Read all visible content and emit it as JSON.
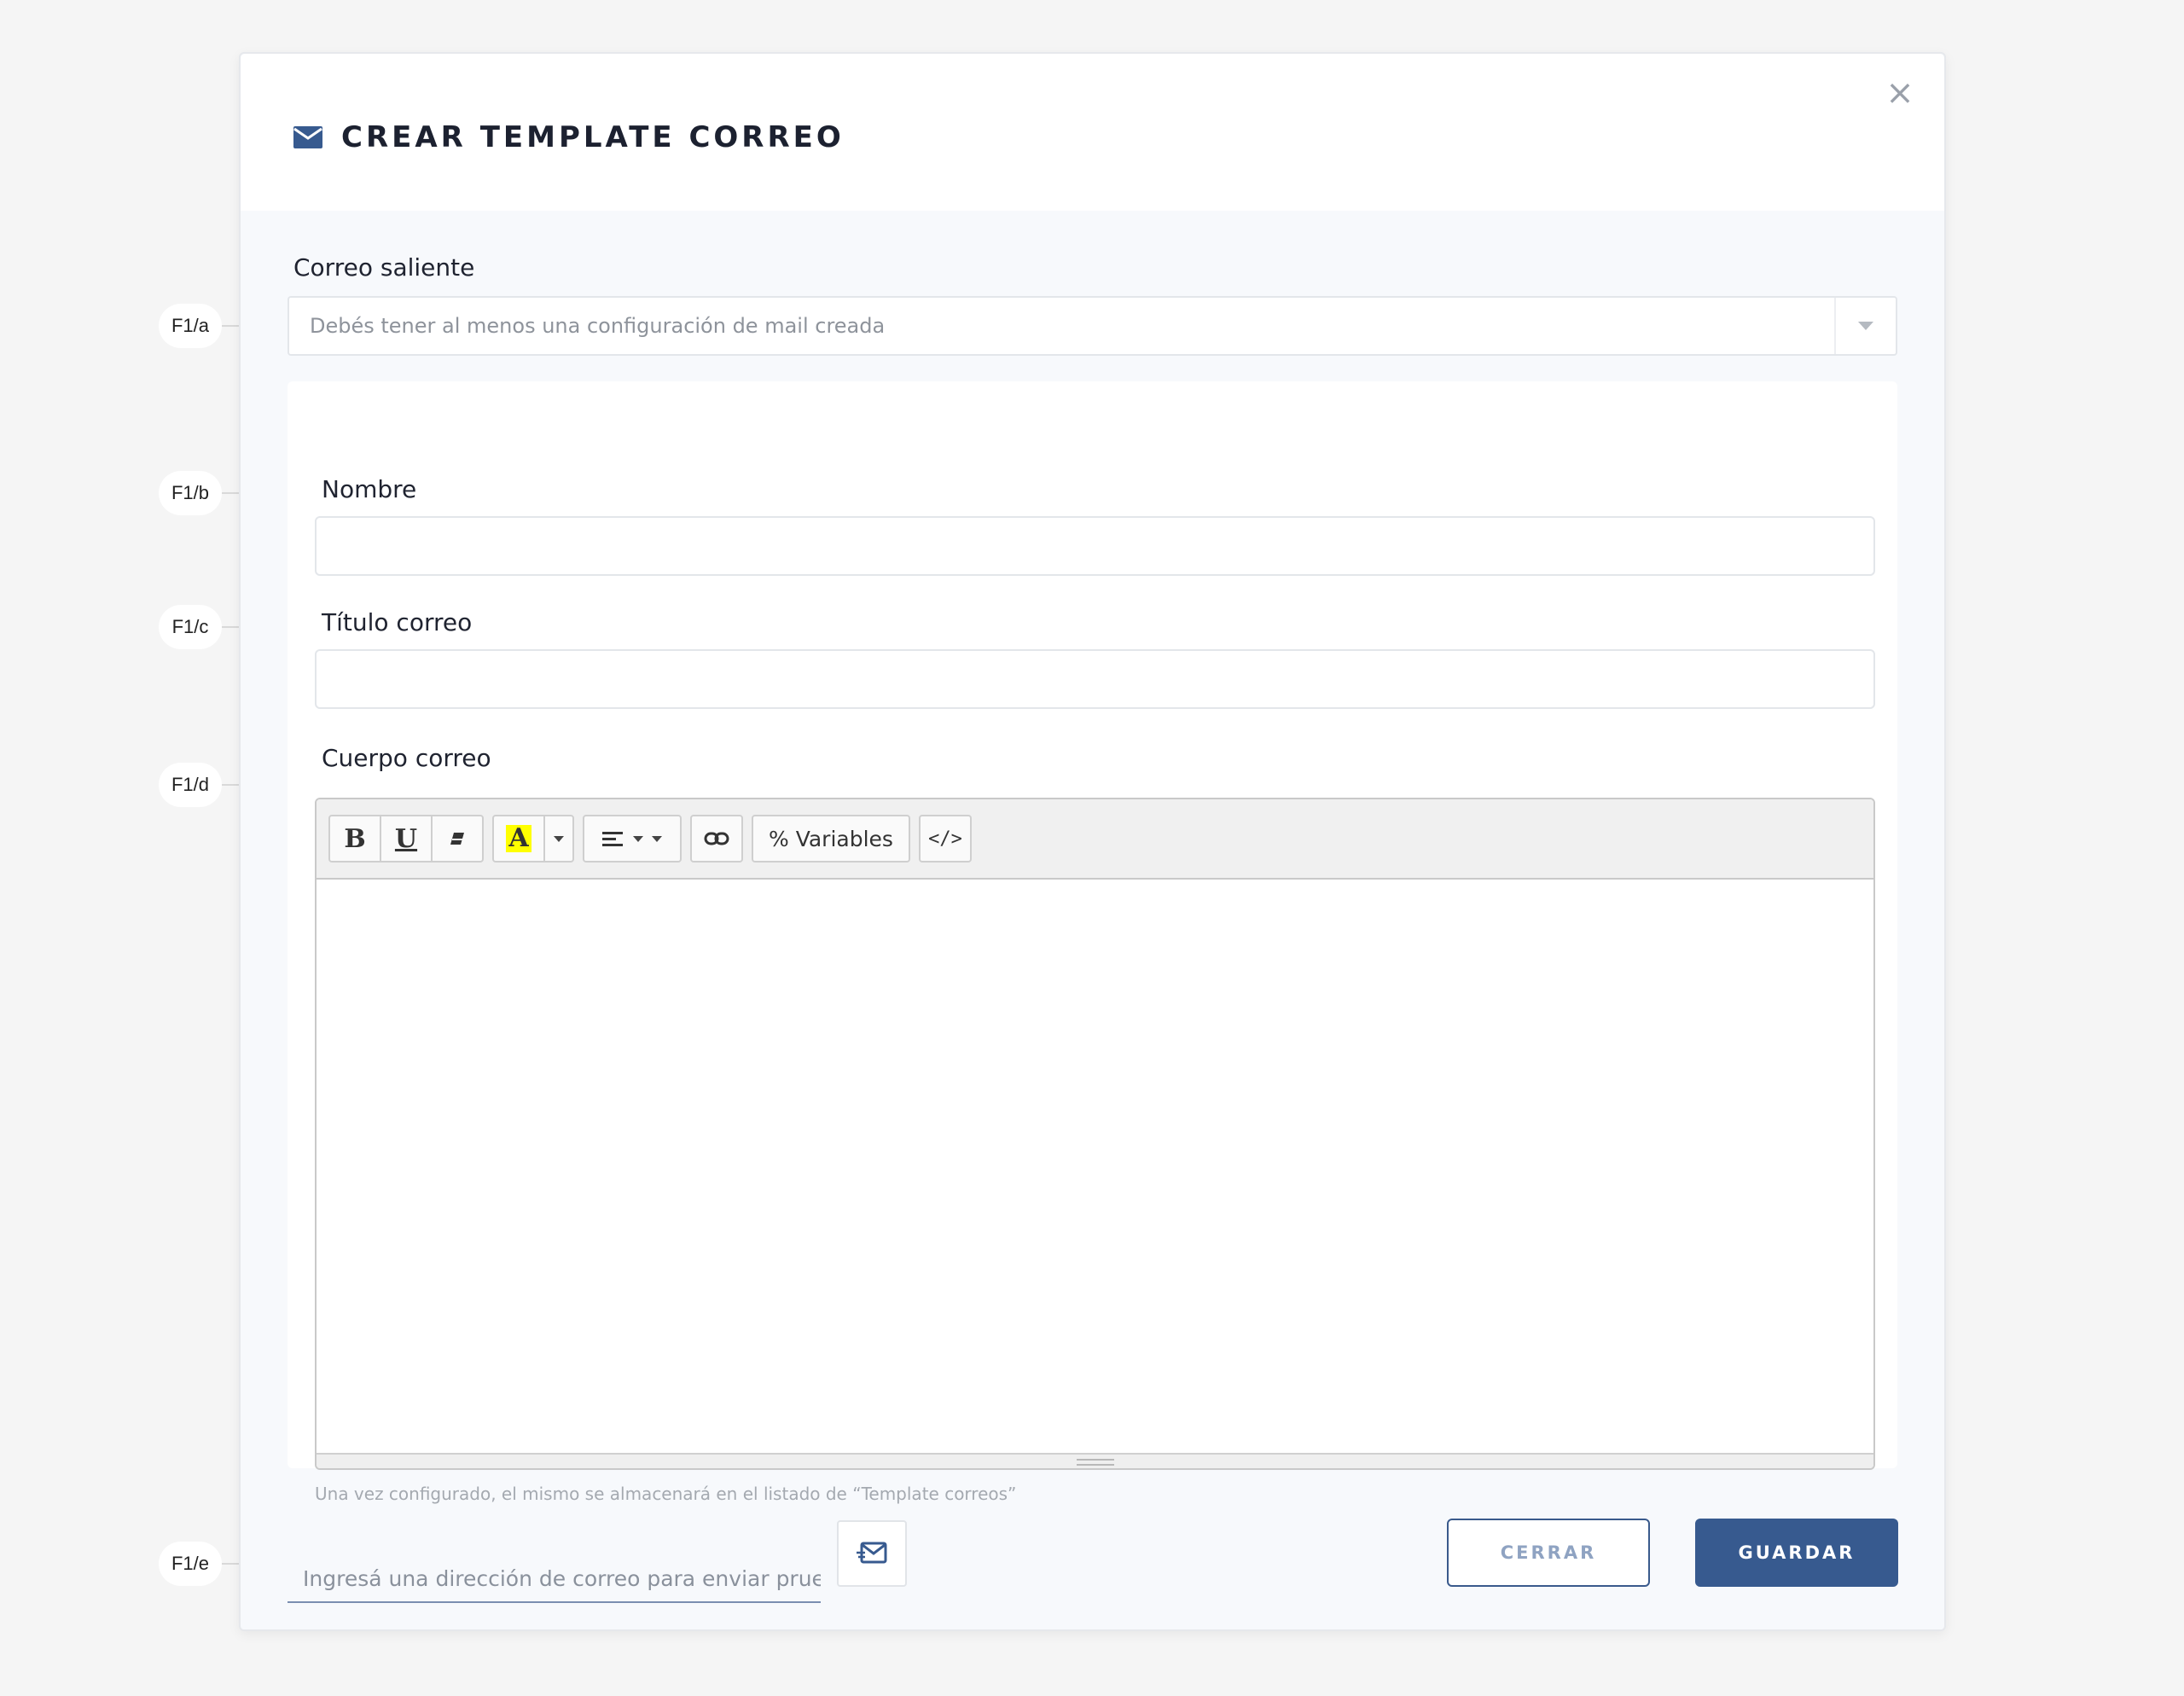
{
  "callouts": {
    "a": "F1/a",
    "b": "F1/b",
    "c": "F1/c",
    "d": "F1/d",
    "e": "F1/e"
  },
  "modal": {
    "title": "CREAR TEMPLATE CORREO",
    "close_symbol": "×",
    "icon": "envelope-icon"
  },
  "form": {
    "outgoing_label": "Correo saliente",
    "outgoing_placeholder": "Debés tener al menos una configuración de mail creada",
    "name_label": "Nombre",
    "name_value": "",
    "subject_label": "Título correo",
    "subject_value": "",
    "body_label": "Cuerpo correo",
    "hint": "Una vez configurado, el mismo se almacenará en el listado de “Template correos”"
  },
  "toolbar": {
    "bold": "B",
    "underline": "U",
    "color": "A",
    "variables": "% Variables",
    "code": "</>"
  },
  "footer": {
    "test_placeholder": "Ingresá una dirección de correo para enviar prueba",
    "close_label": "CERRAR",
    "save_label": "GUARDAR"
  },
  "colors": {
    "primary": "#375a8f",
    "highlight": "#ffff00"
  }
}
